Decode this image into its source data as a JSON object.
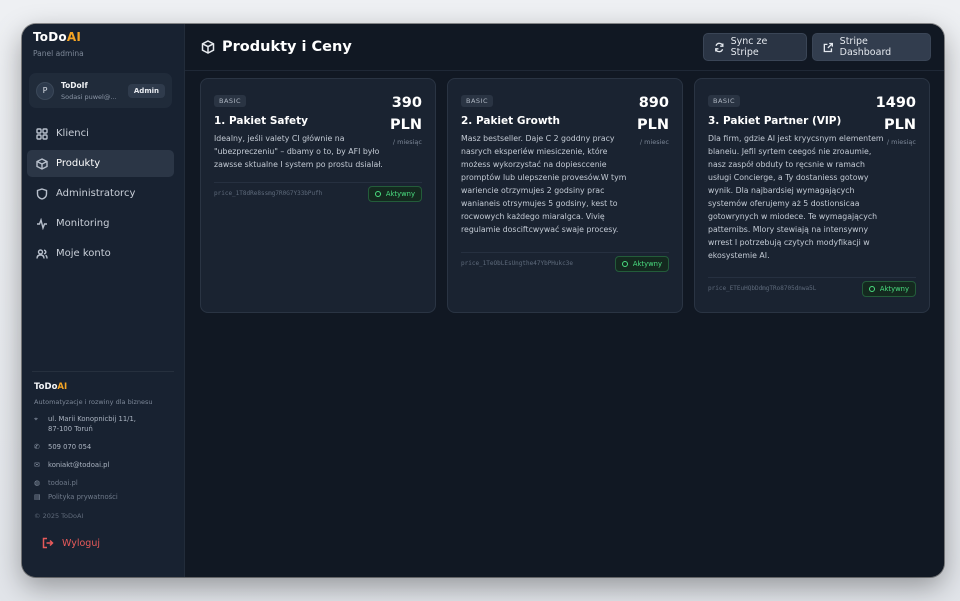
{
  "brand": {
    "name": "ToDo",
    "name_ai": "AI",
    "subtitle": "Panel admina"
  },
  "user": {
    "initial": "P",
    "name": "ToDoIf",
    "email": "Sodasi puwel@...",
    "role": "Admin"
  },
  "nav": [
    {
      "label": "Klienci",
      "icon": "grid-icon"
    },
    {
      "label": "Produkty",
      "icon": "box-icon",
      "active": true
    },
    {
      "label": "Administratorcy",
      "icon": "shield-icon"
    },
    {
      "label": "Monitoring",
      "icon": "activity-icon"
    },
    {
      "label": "Moje konto",
      "icon": "users-icon"
    }
  ],
  "company": {
    "name": "ToDo",
    "name_ai": "AI",
    "tagline": "Automatyzacje i rozwiny dla biznesu",
    "address_line1": "ul. Marii Konopnicbij 11/1,",
    "address_line2": "87-100 Toruń",
    "phone": "509 070 054",
    "email": "koniakt@todoai.pl",
    "website": "todoai.pl",
    "privacy": "Polityka prywatności",
    "copyright": "© 2025 ToDoAI"
  },
  "logout_label": "Wyloguj",
  "header": {
    "title": "Produkty i Ceny",
    "sync_label": "Sync ze Stripe",
    "stripe_label": "Stripe Dashboard"
  },
  "products": [
    {
      "tier": "BASIC",
      "title": "1. Pakiet Safety",
      "price": "390",
      "currency": "PLN",
      "period": "/ miesiąc",
      "description": "Idealny, jeśli valety CI głównie na \"ubezpreczeniu\" – dbamy o to, by AFI było zawsse sktualne I system po prostu dsialał.",
      "price_id": "price_1T8dRe8ssmg7R0G7Y33bPufh",
      "status": "Aktywny"
    },
    {
      "tier": "BASIC",
      "title": "2. Pakiet Growth",
      "price": "890",
      "currency": "PLN",
      "period": "/ miesiec",
      "description": "Masz bestseller. Daje C 2 goddny pracy nasrych eksperiéw miesiczenie, które możess wykorzystać na dopiesccenie promptów lub ulepszenie provesów.W tym wariencie otrzymujes 2 godsiny prac wanianeis otrsymujes 5 godsiny, kest to rocwowych każdego miaralgca. Vivię regulamie dosciftcwywać swaje procesy.",
      "price_id": "price_1TeObLEsUngthe47YbPHukc3e",
      "status": "Aktywny"
    },
    {
      "tier": "BASIC",
      "title": "3. Pakiet Partner (VIP)",
      "price": "1490",
      "currency": "PLN",
      "period": "/ miesiąc",
      "description": "Dla firm, gdzie AI jest kryycsnym elementem blaneiu. Jefil syrtem ceegoś nie zroaumie, nasz zaspół obduty to ręcsnie w ramach usługi Concierge, a Ty dostaniess gotowy wynik. Dla najbardsiej wymagających systemów oferujemy aż 5 dostionsicaa gotowrynych w miodece. Te wymagających patternibs. Mlory stewiają na intensywny wrrest I potrzebują czytych modyfikacji w ekosystemie AI.",
      "price_id": "price_ETEuHQbDdmgTRo8705dnwa5L",
      "status": "Aktywny"
    }
  ]
}
